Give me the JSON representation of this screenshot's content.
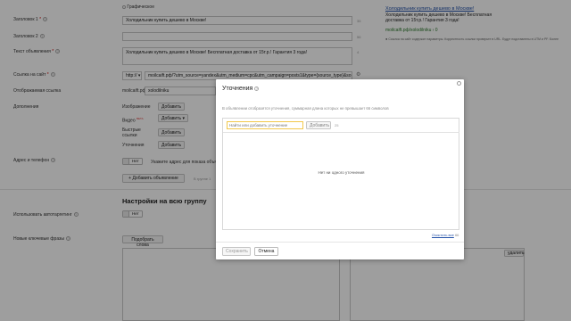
{
  "form": {
    "graphic_label": "Графическое",
    "headline1": {
      "label": "Заголовок 1",
      "value": "Холодильник купить дешево в Москве!",
      "count": "35"
    },
    "headline2": {
      "label": "Заголовок 2",
      "value": "",
      "count": "56"
    },
    "text": {
      "label": "Текст объявления",
      "value": "Холодильник купить дешево в Москве! Бесплатная доставка от 15т.р.! Гарантия 3 года!",
      "count": "4"
    },
    "site_link": {
      "label": "Ссылка на сайт",
      "protocol": "http://",
      "value": "moilcaift.pф/?utm_source=yandex&utm_medium=cpc&utm_campaign=posts1&type={source_type}&sou"
    },
    "display_link": {
      "label": "Отображаемая ссылка",
      "domain": "moilcaift.pф/",
      "value": "xolodilniku",
      "count": "20"
    },
    "additions": {
      "label": "Дополнения",
      "items": [
        {
          "name": "Изображение",
          "button": "Добавить"
        },
        {
          "name": "Видео",
          "beta": "BETA",
          "button": "Добавить"
        },
        {
          "name": "Быстрые ссылки",
          "button": "Добавить"
        },
        {
          "name": "Уточнения",
          "button": "Добавить"
        }
      ]
    },
    "address": {
      "label": "Адрес и телефон",
      "toggle_off": "Нет",
      "hint": "Укажите адрес для показа объявл"
    },
    "add_ad_button": "+ Добавить объявление",
    "add_ad_hint": "В группе 1"
  },
  "group": {
    "title": "Настройки на всю группу",
    "autotargeting": {
      "label": "Использовать автотаргетинг",
      "toggle_off": "Нет"
    },
    "keywords": {
      "label": "Новые ключевые фразы",
      "pick_button": "Подобрать слова"
    },
    "right_button": "удалить"
  },
  "preview": {
    "title": "Холодильник купить дешево в Москве!",
    "text": "Холодильник купить дешево в Москве! Бесплатная доставка от 15т.р.! Гарантия 3 года!",
    "url": "moilcaift.pф/xolodilniku › 0",
    "note": "Ссылка на сайт содержит параметры. Корректность ссылки проверьте в URL. Будут подставлены в UTM и PF. Более"
  },
  "modal": {
    "title": "Уточнения",
    "description": "В объявлении отобразятся уточнения, суммарная длина которых не превышает 66 символов",
    "search_placeholder": "Найти или добавить уточнение",
    "add_button": "Добавить",
    "counter": "25",
    "empty_text": "Нет ни одного уточнения",
    "clear_link": "Очистить все",
    "clear_count": "66",
    "save_button": "Сохранить",
    "cancel_button": "Отмена"
  }
}
